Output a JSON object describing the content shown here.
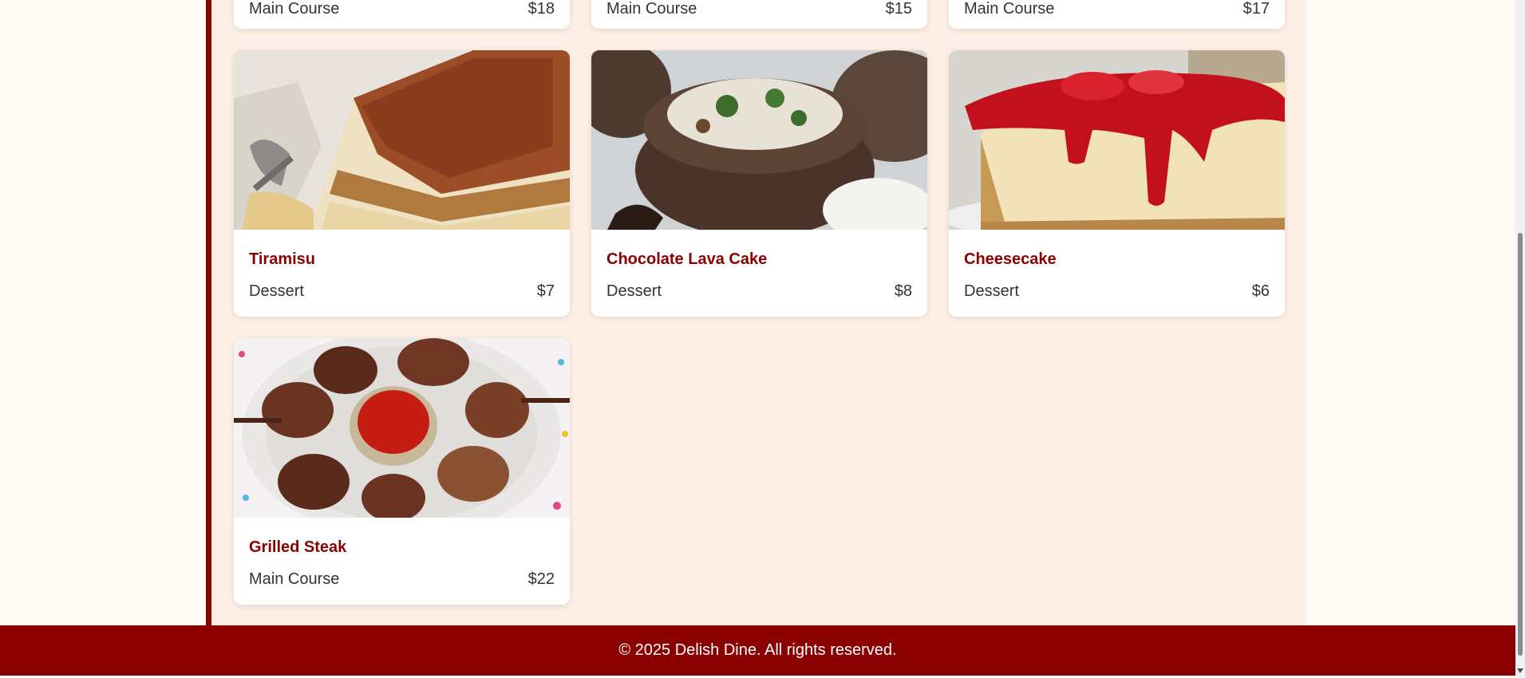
{
  "menu": {
    "items": [
      {
        "name": "",
        "category": "Main Course",
        "price": "$18"
      },
      {
        "name": "",
        "category": "Main Course",
        "price": "$15"
      },
      {
        "name": "",
        "category": "Main Course",
        "price": "$17"
      },
      {
        "name": "Tiramisu",
        "category": "Dessert",
        "price": "$7",
        "image": "tiramisu-photo"
      },
      {
        "name": "Chocolate Lava Cake",
        "category": "Dessert",
        "price": "$8",
        "image": "stuffed-mushroom-photo"
      },
      {
        "name": "Cheesecake",
        "category": "Dessert",
        "price": "$6",
        "image": "cheesecake-photo"
      },
      {
        "name": "Grilled Steak",
        "category": "Main Course",
        "price": "$22",
        "image": "grilled-meat-platter-photo"
      }
    ]
  },
  "footer": {
    "text": "© 2025 Delish Dine. All rights reserved."
  },
  "colors": {
    "brand": "#8b0000",
    "page_background": "#fffbf4",
    "content_background": "#fdefe5",
    "card_background": "#ffffff"
  }
}
